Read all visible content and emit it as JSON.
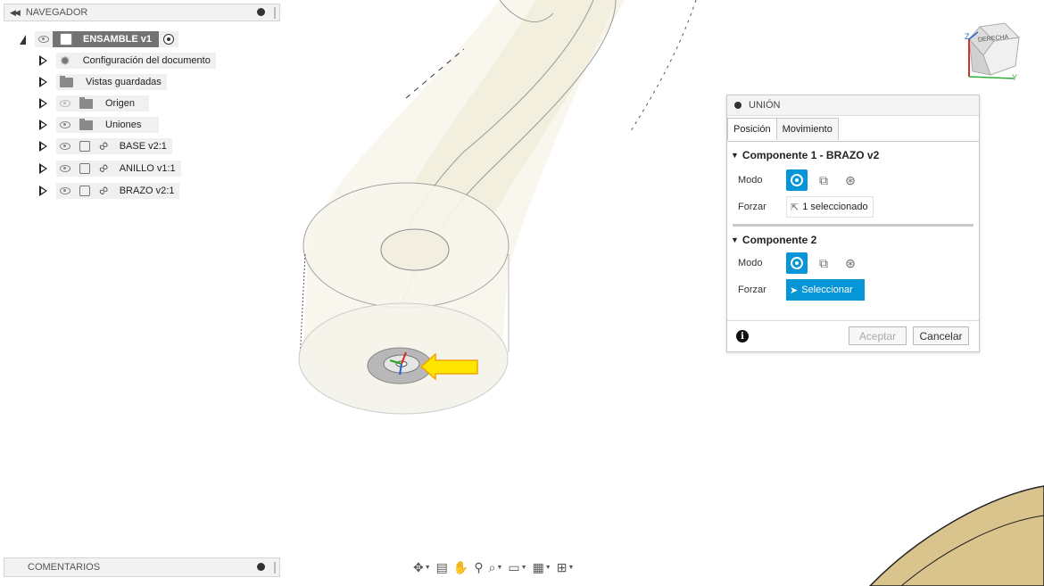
{
  "navigator": {
    "header_label": "NAVEGADOR",
    "root": {
      "label": "ENSAMBLE v1"
    },
    "items": [
      {
        "label": "Configuración del documento",
        "icon": "gear-icon"
      },
      {
        "label": "Vistas guardadas",
        "icon": "folder-icon"
      },
      {
        "label": "Origen",
        "icon": "folder-icon",
        "hidden": true
      },
      {
        "label": "Uniones",
        "icon": "folder-icon"
      },
      {
        "label": "BASE v2:1",
        "icon": "component-link-icon"
      },
      {
        "label": "ANILLO v1:1",
        "icon": "component-link-icon"
      },
      {
        "label": "BRAZO v2:1",
        "icon": "component-link-icon"
      }
    ]
  },
  "comments": {
    "label": "COMENTARIOS"
  },
  "joint_dialog": {
    "title": "UNIÓN",
    "tabs": [
      {
        "label": "Posición",
        "active": true
      },
      {
        "label": "Movimiento",
        "active": false
      }
    ],
    "component1": {
      "title": "Componente 1 - BRAZO v2",
      "mode_label": "Modo",
      "snap_label": "Forzar",
      "snap_value": "1 seleccionado"
    },
    "component2": {
      "title": "Componente 2",
      "mode_label": "Modo",
      "snap_label": "Forzar",
      "snap_value": "Seleccionar"
    },
    "ok_label": "Aceptar",
    "cancel_label": "Cancelar"
  },
  "viewcube": {
    "face_label": "DERECHA",
    "axes": [
      "Z",
      "Y"
    ]
  },
  "colors": {
    "accent_blue": "#0696d7",
    "arrow_yellow": "#ffe600",
    "arrow_outline": "#f0a500",
    "disc_bronze": "#d9c48d"
  },
  "toolbar": {
    "tools": [
      "orbit-icon",
      "look-at-icon",
      "pan-hand-icon",
      "zoom-icon",
      "fit-zoom-icon",
      "display-mode-icon",
      "grid-icon",
      "viewports-icon"
    ]
  }
}
